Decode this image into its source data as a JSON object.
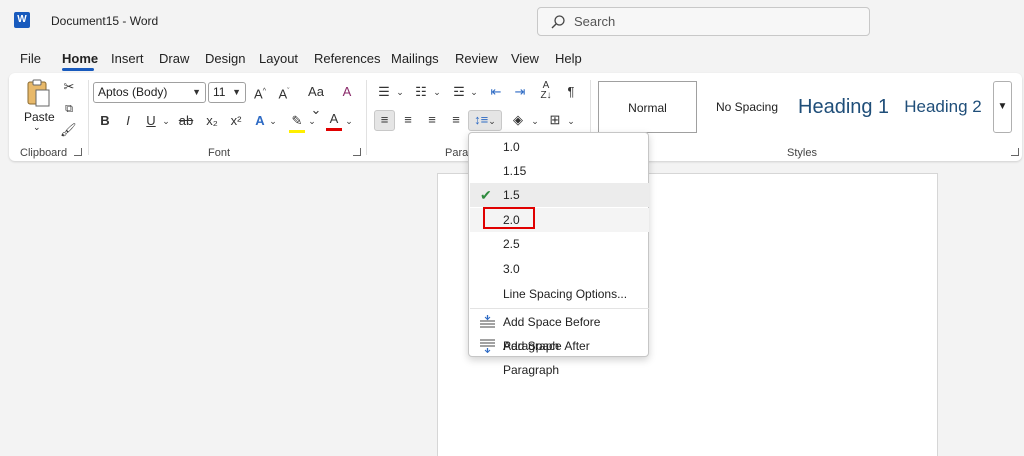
{
  "titlebar": {
    "app_icon": "W",
    "doc_title": "Document15  -  Word"
  },
  "search": {
    "placeholder": "Search"
  },
  "menu": [
    "File",
    "Home",
    "Insert",
    "Draw",
    "Design",
    "Layout",
    "References",
    "Mailings",
    "Review",
    "View",
    "Help"
  ],
  "ribbon": {
    "clipboard": {
      "paste_label": "Paste",
      "group_label": "Clipboard"
    },
    "font": {
      "font_name": "Aptos (Body)",
      "font_size": "11",
      "case_label": "Aa",
      "group_label": "Font",
      "bold": "B",
      "italic": "I",
      "underline": "U",
      "strike": "ab",
      "sub": "x₂",
      "sup": "x²"
    },
    "paragraph": {
      "group_label": "Parag"
    },
    "styles": {
      "normal": "Normal",
      "no_spacing": "No Spacing",
      "heading1": "Heading 1",
      "heading2": "Heading 2",
      "group_label": "Styles"
    }
  },
  "line_spacing_menu": {
    "options": [
      "1.0",
      "1.15",
      "1.5",
      "2.0",
      "2.5",
      "3.0"
    ],
    "checked": "1.5",
    "more_options": "Line Spacing Options...",
    "add_before": "Add Space Before Paragraph",
    "add_after": "Add Space After Paragraph"
  },
  "colors": {
    "accent": "#185abd",
    "highlight_border": "#e00000",
    "check": "#2e8b3e"
  }
}
